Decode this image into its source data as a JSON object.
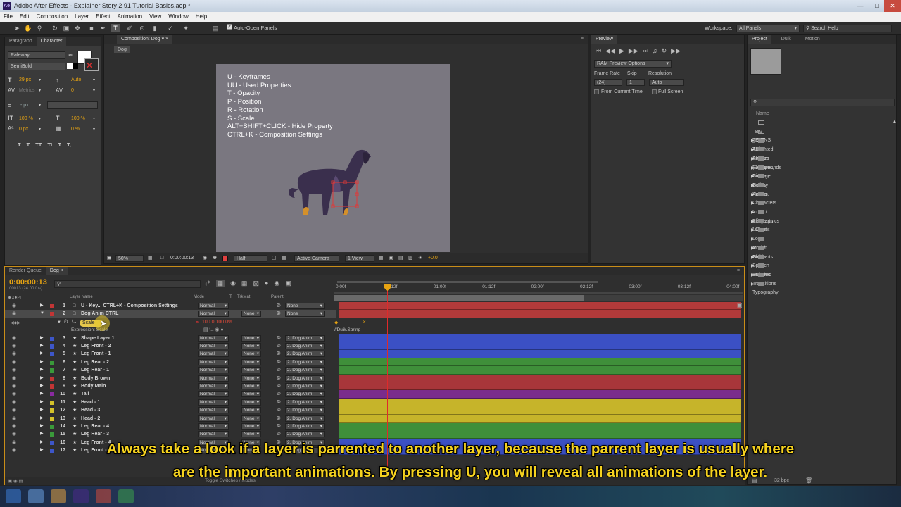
{
  "window": {
    "title": "Adobe After Effects - Explainer Story 2 91 Tutorial Basics.aep *"
  },
  "menu": [
    "File",
    "Edit",
    "Composition",
    "Layer",
    "Effect",
    "Animation",
    "View",
    "Window",
    "Help"
  ],
  "toolbar": {
    "auto_open_panels": "Auto-Open Panels",
    "workspace_label": "Workspace:",
    "workspace_value": "All Panels",
    "search_help": "Search Help"
  },
  "left_panel": {
    "tabs": [
      "Paragraph",
      "Character"
    ],
    "font_family": "Raleway",
    "font_style": "SemiBold",
    "font_size": "29 px",
    "leading": "Auto",
    "tracking_label": "Metrics",
    "tracking_value": "0",
    "stroke_unit": "- px",
    "vscale": "100 %",
    "hscale": "100 %",
    "baseline": "0 px",
    "tsume": "0 %",
    "style_buttons": [
      "T",
      "T",
      "TT",
      "Tt",
      "T",
      "T,"
    ]
  },
  "composition": {
    "tab": "Composition: Dog",
    "crumb": "Dog",
    "zoom": "50%",
    "timecode": "0:00:00:13",
    "resolution": "Half",
    "camera": "Active Camera",
    "views": "1 View",
    "exposure": "+0.0",
    "shortcuts": [
      "U - Keyframes",
      "UU - Used Properties",
      "T - Opacity",
      "P - Position",
      "R - Rotation",
      "S - Scale",
      "ALT+SHIFT+CLICK - Hide Property",
      "CTRL+K - Composition Settings"
    ]
  },
  "preview": {
    "tab": "Preview",
    "ram_options": "RAM Preview Options",
    "frame_rate_label": "Frame Rate",
    "frame_rate": "(24)",
    "skip_label": "Skip",
    "skip": "1",
    "resolution_label": "Resolution",
    "resolution": "Auto",
    "from_current": "From Current Time",
    "full_screen": "Full Screen"
  },
  "project": {
    "tabs": [
      "Project",
      "Duik",
      "Motion"
    ],
    "name_header": "Name",
    "items": [
      {
        "name": "_BG TEST",
        "type": "comp"
      },
      {
        "name": "_ICONS TEST",
        "type": "comp"
      },
      {
        "name": "Aniamted Shapes (Squares, Circles, Boxes, Arrows, ...",
        "type": "folder"
      },
      {
        "name": "Avatars",
        "type": "folder"
      },
      {
        "name": "Backgrounds",
        "type": "folder"
      },
      {
        "name": "Footage",
        "type": "folder"
      },
      {
        "name": "Gallery",
        "type": "folder"
      },
      {
        "name": "Hands",
        "type": "folder"
      },
      {
        "name": "Characters",
        "type": "folder"
      },
      {
        "name": "Icons / Elements",
        "type": "folder"
      },
      {
        "name": "Infographics / Charts",
        "type": "folder"
      },
      {
        "name": "Labels",
        "type": "folder"
      },
      {
        "name": "Logo Intro / Outro",
        "type": "folder"
      },
      {
        "name": "Motion Elements",
        "type": "folder"
      },
      {
        "name": "Solids",
        "type": "folder"
      },
      {
        "name": "Speech Bubbles",
        "type": "folder"
      },
      {
        "name": "Textures",
        "type": "folder"
      },
      {
        "name": "Transitions",
        "type": "folder"
      },
      {
        "name": "Typography",
        "type": "folder"
      }
    ],
    "bpc": "32 bpc"
  },
  "timeline": {
    "tabs": [
      "Render Queue",
      "Dog"
    ],
    "timecode": "0:00:00:13",
    "frame_info": "00013 (24.00 fps)",
    "headers": {
      "layer_name": "Layer Name",
      "mode": "Mode",
      "t": "T",
      "trkmat": "TrkMat",
      "parent": "Parent"
    },
    "ruler": [
      "0:00f",
      "00:12f",
      "01:00f",
      "01:12f",
      "02:00f",
      "02:12f",
      "03:00f",
      "03:12f",
      "04:00f"
    ],
    "scale_prop": "Scale",
    "scale_value": "100.0,100.0%",
    "expression_label": "Expression: Scale",
    "expression_text": "//Duik.Spring",
    "toggle_label": "Toggle Switches / Modes",
    "layers": [
      {
        "num": "1",
        "name": "U - Key... CTRL+K - Composition Settings",
        "mode": "Normal",
        "trk": "",
        "parent": "None",
        "color": "#c23535",
        "bar": "#b23a3a"
      },
      {
        "num": "2",
        "name": "Dog Anim CTRL",
        "mode": "Normal",
        "trk": "None",
        "parent": "None",
        "color": "#c23535",
        "bar": "#b23a3a"
      },
      {
        "num": "3",
        "name": "Shape Layer 1",
        "mode": "Normal",
        "trk": "None",
        "parent": "2. Dog Anim",
        "color": "#3d56c9",
        "bar": "#3b50c4"
      },
      {
        "num": "4",
        "name": "Leg Front - 2",
        "mode": "Normal",
        "trk": "None",
        "parent": "2. Dog Anim",
        "color": "#3d56c9",
        "bar": "#3b50c4"
      },
      {
        "num": "5",
        "name": "Leg Front - 1",
        "mode": "Normal",
        "trk": "None",
        "parent": "2. Dog Anim",
        "color": "#3d56c9",
        "bar": "#3b50c4"
      },
      {
        "num": "6",
        "name": "Leg Rear - 2",
        "mode": "Normal",
        "trk": "None",
        "parent": "2. Dog Anim",
        "color": "#3a9a3a",
        "bar": "#3f8f3a"
      },
      {
        "num": "7",
        "name": "Leg Rear - 1",
        "mode": "Normal",
        "trk": "None",
        "parent": "2. Dog Anim",
        "color": "#3a9a3a",
        "bar": "#3f8f3a"
      },
      {
        "num": "8",
        "name": "Body Brown",
        "mode": "Normal",
        "trk": "None",
        "parent": "2. Dog Anim",
        "color": "#c23535",
        "bar": "#a8363a"
      },
      {
        "num": "9",
        "name": "Body Main",
        "mode": "Normal",
        "trk": "None",
        "parent": "2. Dog Anim",
        "color": "#c23535",
        "bar": "#a8363a"
      },
      {
        "num": "10",
        "name": "Tail",
        "mode": "Normal",
        "trk": "None",
        "parent": "2. Dog Anim",
        "color": "#8a2aa0",
        "bar": "#7a2c8c"
      },
      {
        "num": "11",
        "name": "Head - 1",
        "mode": "Normal",
        "trk": "None",
        "parent": "2. Dog Anim",
        "color": "#d4c22a",
        "bar": "#c6b42a"
      },
      {
        "num": "12",
        "name": "Head - 3",
        "mode": "Normal",
        "trk": "None",
        "parent": "2. Dog Anim",
        "color": "#d4c22a",
        "bar": "#c6b42a"
      },
      {
        "num": "13",
        "name": "Head - 2",
        "mode": "Normal",
        "trk": "None",
        "parent": "2. Dog Anim",
        "color": "#d4c22a",
        "bar": "#c6b42a"
      },
      {
        "num": "14",
        "name": "Leg Rear - 4",
        "mode": "Normal",
        "trk": "None",
        "parent": "2. Dog Anim",
        "color": "#3a9a3a",
        "bar": "#3f8f3a"
      },
      {
        "num": "15",
        "name": "Leg Rear - 3",
        "mode": "Normal",
        "trk": "None",
        "parent": "2. Dog Anim",
        "color": "#3a9a3a",
        "bar": "#3f8f3a"
      },
      {
        "num": "16",
        "name": "Leg Front - 4",
        "mode": "Normal",
        "trk": "None",
        "parent": "2. Dog Anim",
        "color": "#3d56c9",
        "bar": "#3b50c4"
      },
      {
        "num": "17",
        "name": "Leg Front - 3",
        "mode": "Normal",
        "trk": "None",
        "parent": "2. Dog Anim",
        "color": "#3d56c9",
        "bar": "#3b50c4"
      }
    ]
  },
  "subtitle": {
    "line1": "Always take a look if a layer is parrented to another layer, because the parrent layer is usually where",
    "line2": "are the important animations. By pressing U, you will reveal all animations of the layer."
  },
  "colors": {
    "accent_orange": "#e6a312",
    "playhead": "#e02a2a",
    "canvas": "#7a7780",
    "dog": "#3a2f4d"
  }
}
